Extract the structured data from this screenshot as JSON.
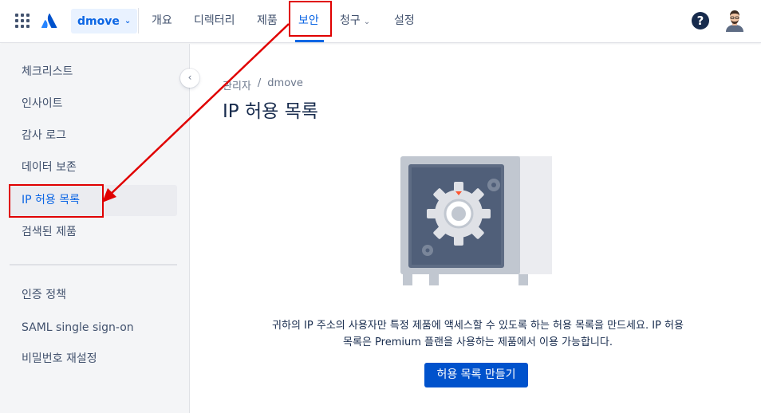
{
  "topbar": {
    "site": "dmove",
    "nav": [
      "개요",
      "디렉터리",
      "제품",
      "보안",
      "청구",
      "설정"
    ],
    "active_nav": "보안",
    "help": "?"
  },
  "sidebar": {
    "items": [
      "체크리스트",
      "인사이트",
      "감사 로그",
      "데이터 보존",
      "IP 허용 목록",
      "검색된 제품"
    ],
    "items2": [
      "인증 정책",
      "SAML single sign-on",
      "비밀번호 재설정"
    ],
    "selected": "IP 허용 목록"
  },
  "main": {
    "breadcrumb": [
      "관리자",
      "/",
      "dmove"
    ],
    "title": "IP 허용 목록",
    "desc_line1": "귀하의 IP 주소의 사용자만 특정 제품에 액세스할 수 있도록 하는 허용 목록을 만드세요. IP 허용",
    "desc_line2": "목록은 Premium 플랜을 사용하는 제품에서 이용 가능합니다.",
    "button": "허용 목록 만들기"
  },
  "colors": {
    "accent": "#0c66e4",
    "button": "#0052cc",
    "annotation": "#e00000"
  }
}
